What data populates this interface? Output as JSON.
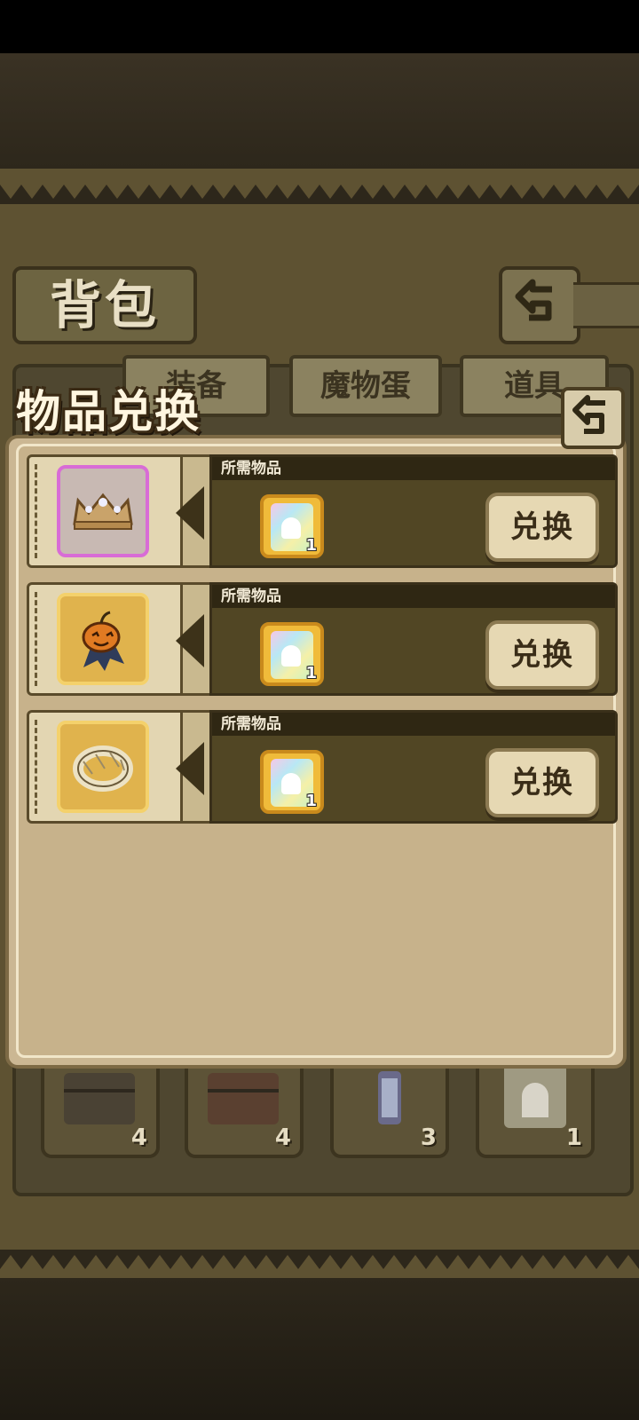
{
  "background": {
    "title": "背包",
    "tabs": [
      "装备",
      "魔物蛋",
      "道具"
    ],
    "slots": [
      {
        "icon": "chest-icon",
        "count": "4"
      },
      {
        "icon": "chest-icon",
        "count": "4"
      },
      {
        "icon": "lantern-icon",
        "count": "3"
      },
      {
        "icon": "ghost-cube-icon",
        "count": "1"
      }
    ]
  },
  "dialog": {
    "title": "物品兑换",
    "rows": [
      {
        "item_icon": "crown-icon",
        "rarity": "purple",
        "req_label": "所需物品",
        "req_icon": "ghost-cube-icon",
        "req_qty": "1",
        "button": "兑换"
      },
      {
        "item_icon": "pumpkin-cape-icon",
        "rarity": "gold",
        "req_label": "所需物品",
        "req_icon": "ghost-cube-icon",
        "req_qty": "1",
        "button": "兑换"
      },
      {
        "item_icon": "bandage-ring-icon",
        "rarity": "gold",
        "req_label": "所需物品",
        "req_icon": "ghost-cube-icon",
        "req_qty": "1",
        "button": "兑换"
      }
    ]
  },
  "colors": {
    "purple_frame": "#d86cd6",
    "gold_frame": "#f4d16b",
    "panel": "#c7b28b"
  }
}
